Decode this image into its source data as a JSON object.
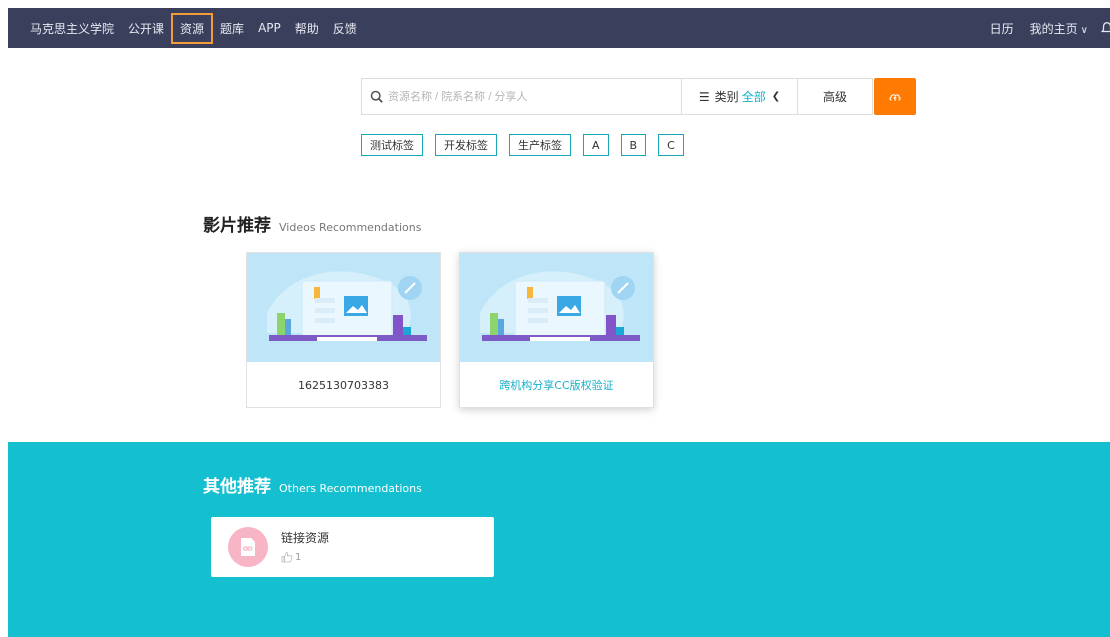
{
  "nav": {
    "items": [
      "马克思主义学院",
      "公开课",
      "资源",
      "题库",
      "APP",
      "帮助",
      "反馈"
    ],
    "active_index": 2,
    "right": {
      "calendar": "日历",
      "my_home": "我的主页"
    }
  },
  "search": {
    "placeholder": "资源名称 / 院系名称 / 分享人",
    "category_label": "类别",
    "category_value": "全部",
    "advanced_label": "高级"
  },
  "tags": [
    "测试标签",
    "开发标签",
    "生产标签",
    "A",
    "B",
    "C"
  ],
  "videos": {
    "title": "影片推荐",
    "subtitle": "Videos Recommendations",
    "items": [
      {
        "caption": "1625130703383"
      },
      {
        "caption": "跨机构分享CC版权验证"
      }
    ]
  },
  "others": {
    "title": "其他推荐",
    "subtitle": "Others Recommendations",
    "items": [
      {
        "title": "链接资源",
        "likes": "1"
      }
    ]
  },
  "colors": {
    "nav_bg": "#3a3f5c",
    "accent_teal": "#14c0d0",
    "upload_orange": "#ff7a00",
    "active_outline": "#f29b38"
  },
  "icons": [
    "search-icon",
    "menu-icon",
    "chevron-down-icon",
    "upload-cloud-icon",
    "bell-icon",
    "thumbs-up-icon",
    "link-file-icon"
  ]
}
